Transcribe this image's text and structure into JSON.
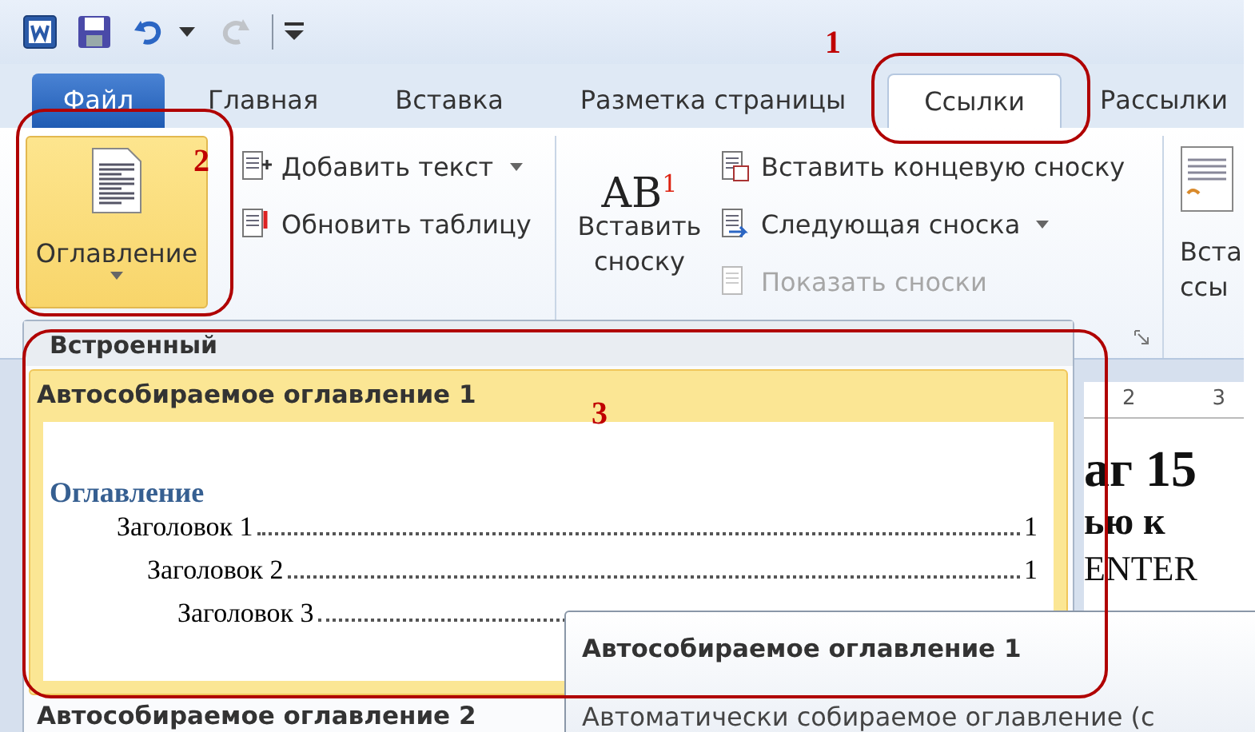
{
  "quick_access": [
    {
      "kind": "app",
      "disabled": false
    },
    {
      "kind": "save",
      "disabled": false
    },
    {
      "kind": "undo",
      "disabled": false
    },
    {
      "kind": "caret",
      "disabled": false
    },
    {
      "kind": "redo",
      "disabled": true
    },
    {
      "kind": "customize",
      "disabled": false
    }
  ],
  "tabs": [
    {
      "label": "Файл",
      "kind": "file",
      "selected": false
    },
    {
      "label": "Главная",
      "kind": "tab",
      "selected": false
    },
    {
      "label": "Вставка",
      "kind": "tab",
      "selected": false
    },
    {
      "label": "Разметка страницы",
      "kind": "tab",
      "selected": false
    },
    {
      "label": "Ссылки",
      "kind": "tab",
      "selected": true
    },
    {
      "label": "Рассылки",
      "kind": "tab",
      "selected": false
    }
  ],
  "ribbon": [
    {
      "large_button": {
        "kind": "toc",
        "lines": [
          "Оглавление"
        ],
        "dropdown": true,
        "pressed": true
      },
      "small_buttons": [
        {
          "kind": "add-text",
          "label": "Добавить текст",
          "dropdown": true,
          "disabled": false
        },
        {
          "kind": "update",
          "label": "Обновить таблицу",
          "dropdown": false,
          "disabled": false
        }
      ],
      "launcher": false
    },
    {
      "large_button": {
        "kind": "footnote",
        "icon_text": "AB",
        "icon_sup": "1",
        "lines": [
          "Вставить",
          "сноску"
        ],
        "dropdown": false,
        "pressed": false
      },
      "small_buttons": [
        {
          "kind": "endnote",
          "label": "Вставить концевую сноску",
          "dropdown": false,
          "disabled": false
        },
        {
          "kind": "next",
          "label": "Следующая сноска",
          "dropdown": true,
          "disabled": false
        },
        {
          "kind": "show",
          "label": "Показать сноски",
          "dropdown": false,
          "disabled": true
        }
      ],
      "launcher": true
    },
    {
      "large_button": {
        "kind": "citation",
        "lines": [
          "Вста",
          "ссы"
        ],
        "dropdown": false,
        "pressed": false
      },
      "launcher": false
    }
  ],
  "document": {
    "ruler": [
      "2",
      "3"
    ],
    "lines": [
      "аг 15",
      "ью к",
      "ENTER"
    ]
  },
  "gallery": {
    "section": "Встроенный",
    "items": [
      {
        "title": "Автособираемое оглавление 1",
        "selected": true,
        "preview": {
          "heading": "Оглавление",
          "entries": [
            {
              "text": "Заголовок 1",
              "page": "1",
              "children": [
                {
                  "text": "Заголовок 2",
                  "page": "1",
                  "children": [
                    {
                      "text": "Заголовок 3"
                    }
                  ]
                }
              ]
            }
          ]
        }
      },
      {
        "title": "Автособираемое оглавление 2",
        "selected": false
      }
    ]
  },
  "tooltip": {
    "title": "Автособираемое оглавление 1",
    "text": "Автоматически собираемое оглавление (с"
  },
  "annotations": [
    {
      "label": "1"
    },
    {
      "label": "2"
    },
    {
      "label": "3"
    }
  ]
}
